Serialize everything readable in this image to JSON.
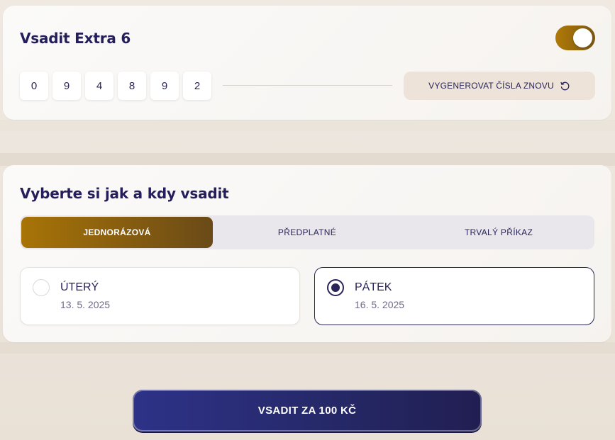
{
  "extra": {
    "title": "Vsadit Extra 6",
    "toggle_on": true,
    "digits": [
      "0",
      "9",
      "4",
      "8",
      "9",
      "2"
    ],
    "regen_label": "VYGENEROVAT ČÍSLA ZNOVU",
    "regen_icon": "refresh-icon"
  },
  "choose": {
    "title": "Vyberte si jak a kdy vsadit",
    "tabs": [
      {
        "label": "JEDNORÁZOVÁ",
        "active": true
      },
      {
        "label": "PŘEDPLATNÉ",
        "active": false
      },
      {
        "label": "TRVALÝ PŘÍKAZ",
        "active": false
      }
    ],
    "days": [
      {
        "name": "ÚTERÝ",
        "date": "13. 5. 2025",
        "selected": false
      },
      {
        "name": "PÁTEK",
        "date": "16. 5. 2025",
        "selected": true
      }
    ]
  },
  "bet_button": {
    "label": "VSADIT ZA 100 KČ"
  },
  "colors": {
    "primary_navy": "#2a2558",
    "accent_gold": "#a87407",
    "background": "#efe9e1"
  }
}
